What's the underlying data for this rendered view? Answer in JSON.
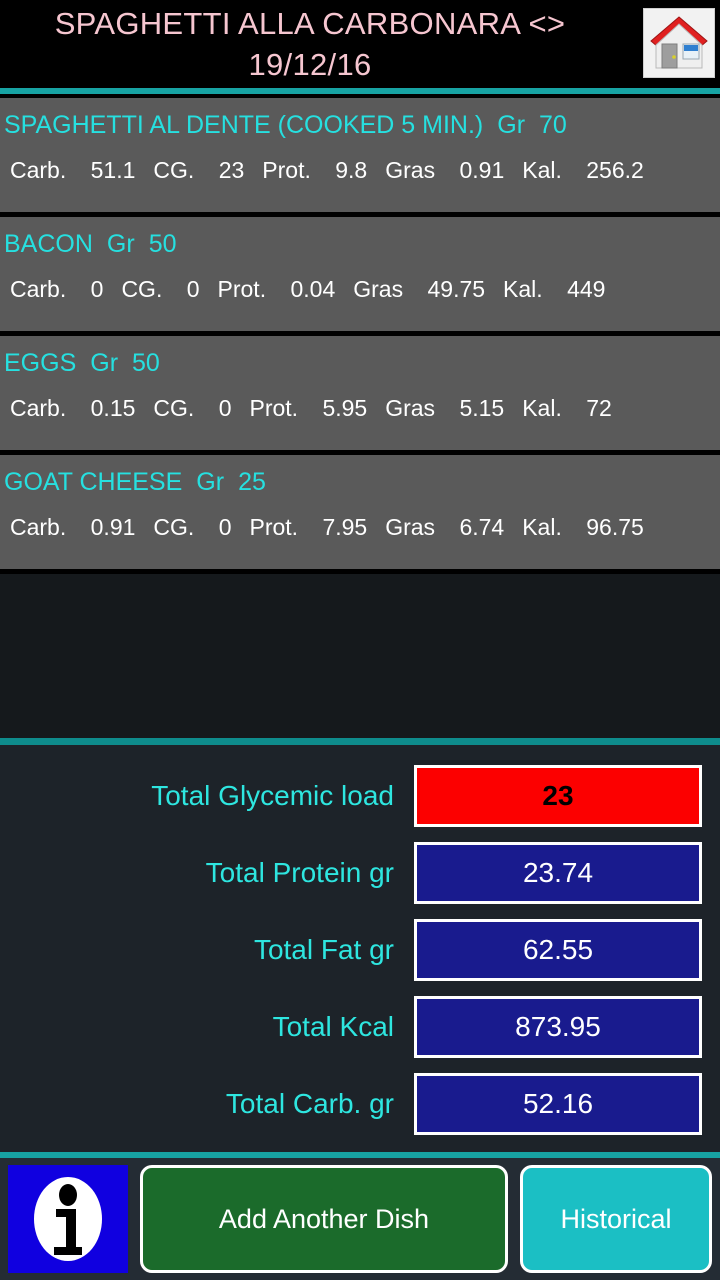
{
  "header": {
    "title": "SPAGHETTI ALLA CARBONARA <>\n19/12/16",
    "home_icon": "home-icon"
  },
  "ingredients": [
    {
      "name": "SPAGHETTI AL DENTE (COOKED 5 MIN.)",
      "gr_label": "Gr",
      "gr_value": "70",
      "carb_label": "Carb.",
      "carb_value": "51.1",
      "cg_label": "CG.",
      "cg_value": "23",
      "prot_label": "Prot.",
      "prot_value": "9.8",
      "gras_label": "Gras",
      "gras_value": "0.91",
      "kal_label": "Kal.",
      "kal_value": "256.2"
    },
    {
      "name": "BACON",
      "gr_label": "Gr",
      "gr_value": "50",
      "carb_label": "Carb.",
      "carb_value": "0",
      "cg_label": "CG.",
      "cg_value": "0",
      "prot_label": "Prot.",
      "prot_value": "0.04",
      "gras_label": "Gras",
      "gras_value": "49.75",
      "kal_label": "Kal.",
      "kal_value": "449"
    },
    {
      "name": "EGGS",
      "gr_label": "Gr",
      "gr_value": "50",
      "carb_label": "Carb.",
      "carb_value": "0.15",
      "cg_label": "CG.",
      "cg_value": "0",
      "prot_label": "Prot.",
      "prot_value": "5.95",
      "gras_label": "Gras",
      "gras_value": "5.15",
      "kal_label": "Kal.",
      "kal_value": "72"
    },
    {
      "name": "GOAT CHEESE",
      "gr_label": "Gr",
      "gr_value": "25",
      "carb_label": "Carb.",
      "carb_value": "0.91",
      "cg_label": "CG.",
      "cg_value": "0",
      "prot_label": "Prot.",
      "prot_value": "7.95",
      "gras_label": "Gras",
      "gras_value": "6.74",
      "kal_label": "Kal.",
      "kal_value": "96.75"
    }
  ],
  "totals": [
    {
      "label": "Total Glycemic load",
      "value": "23",
      "style": "alert"
    },
    {
      "label": "Total Protein gr",
      "value": "23.74",
      "style": "normal"
    },
    {
      "label": "Total Fat gr",
      "value": "62.55",
      "style": "normal"
    },
    {
      "label": "Total Kcal",
      "value": "873.95",
      "style": "normal"
    },
    {
      "label": "Total Carb. gr",
      "value": "52.16",
      "style": "normal"
    }
  ],
  "bottom_bar": {
    "info_icon": "info-icon",
    "add_dish_label": "Add Another Dish",
    "historical_label": "Historical"
  },
  "colors": {
    "accent_cyan": "#26e0e0",
    "title_pink": "#f6c6d0",
    "alert_red": "#fc0000",
    "value_navy": "#191b8e",
    "divider_teal": "#17a3a3",
    "add_dish_green": "#1b6b2b",
    "historical_cyan": "#1bbfc4",
    "info_blue": "#1000e0",
    "row_gray": "#5a5a5a"
  }
}
